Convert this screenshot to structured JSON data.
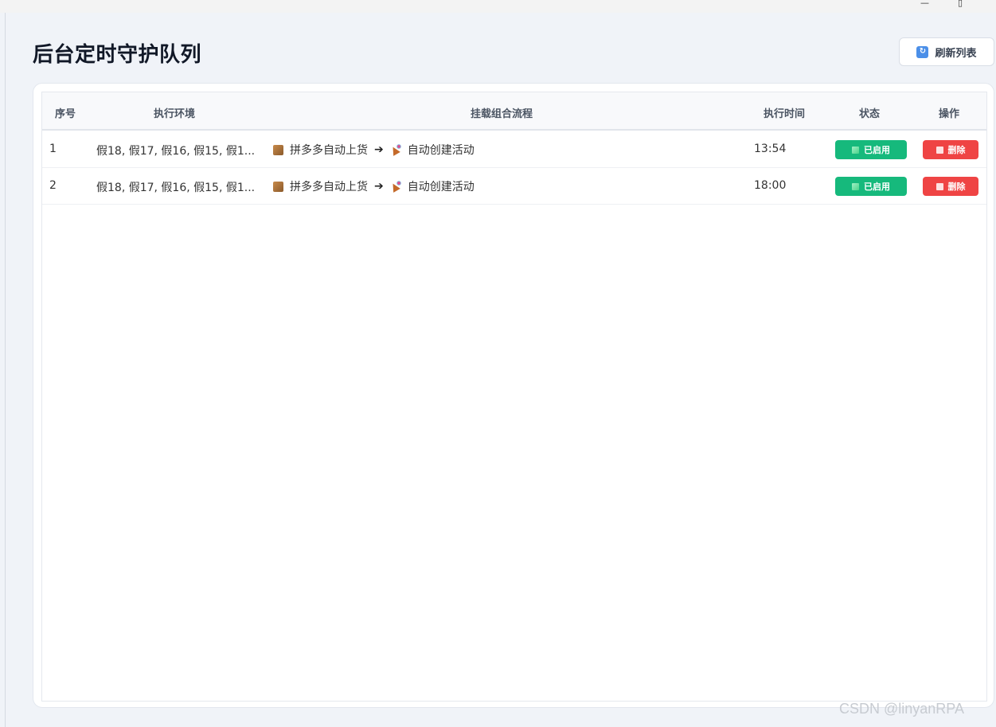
{
  "window": {
    "minimize_glyph": "—",
    "maximize_glyph": "▯"
  },
  "page": {
    "title": "后台定时守护队列"
  },
  "toolbar": {
    "refresh_label": "刷新列表",
    "refresh_icon": "🔄"
  },
  "table": {
    "headers": {
      "index": "序号",
      "env": "执行环境",
      "flow": "挂载组合流程",
      "time": "执行时间",
      "status": "状态",
      "action": "操作"
    },
    "rows": [
      {
        "index": "1",
        "env": "假18, 假17, 假16, 假15, 假1...",
        "flow_step1": "拼多多自动上货",
        "arrow": "➔",
        "flow_step2": "自动创建活动",
        "time": "13:54",
        "status_label": "已启用",
        "action_label": "删除"
      },
      {
        "index": "2",
        "env": "假18, 假17, 假16, 假15, 假1...",
        "flow_step1": "拼多多自动上货",
        "arrow": "➔",
        "flow_step2": "自动创建活动",
        "time": "18:00",
        "status_label": "已启用",
        "action_label": "删除"
      }
    ]
  },
  "watermark": "CSDN @linyanRPA",
  "colors": {
    "status_green": "#16b97c",
    "delete_red": "#ef4444",
    "refresh_blue": "#4b8fe8"
  }
}
